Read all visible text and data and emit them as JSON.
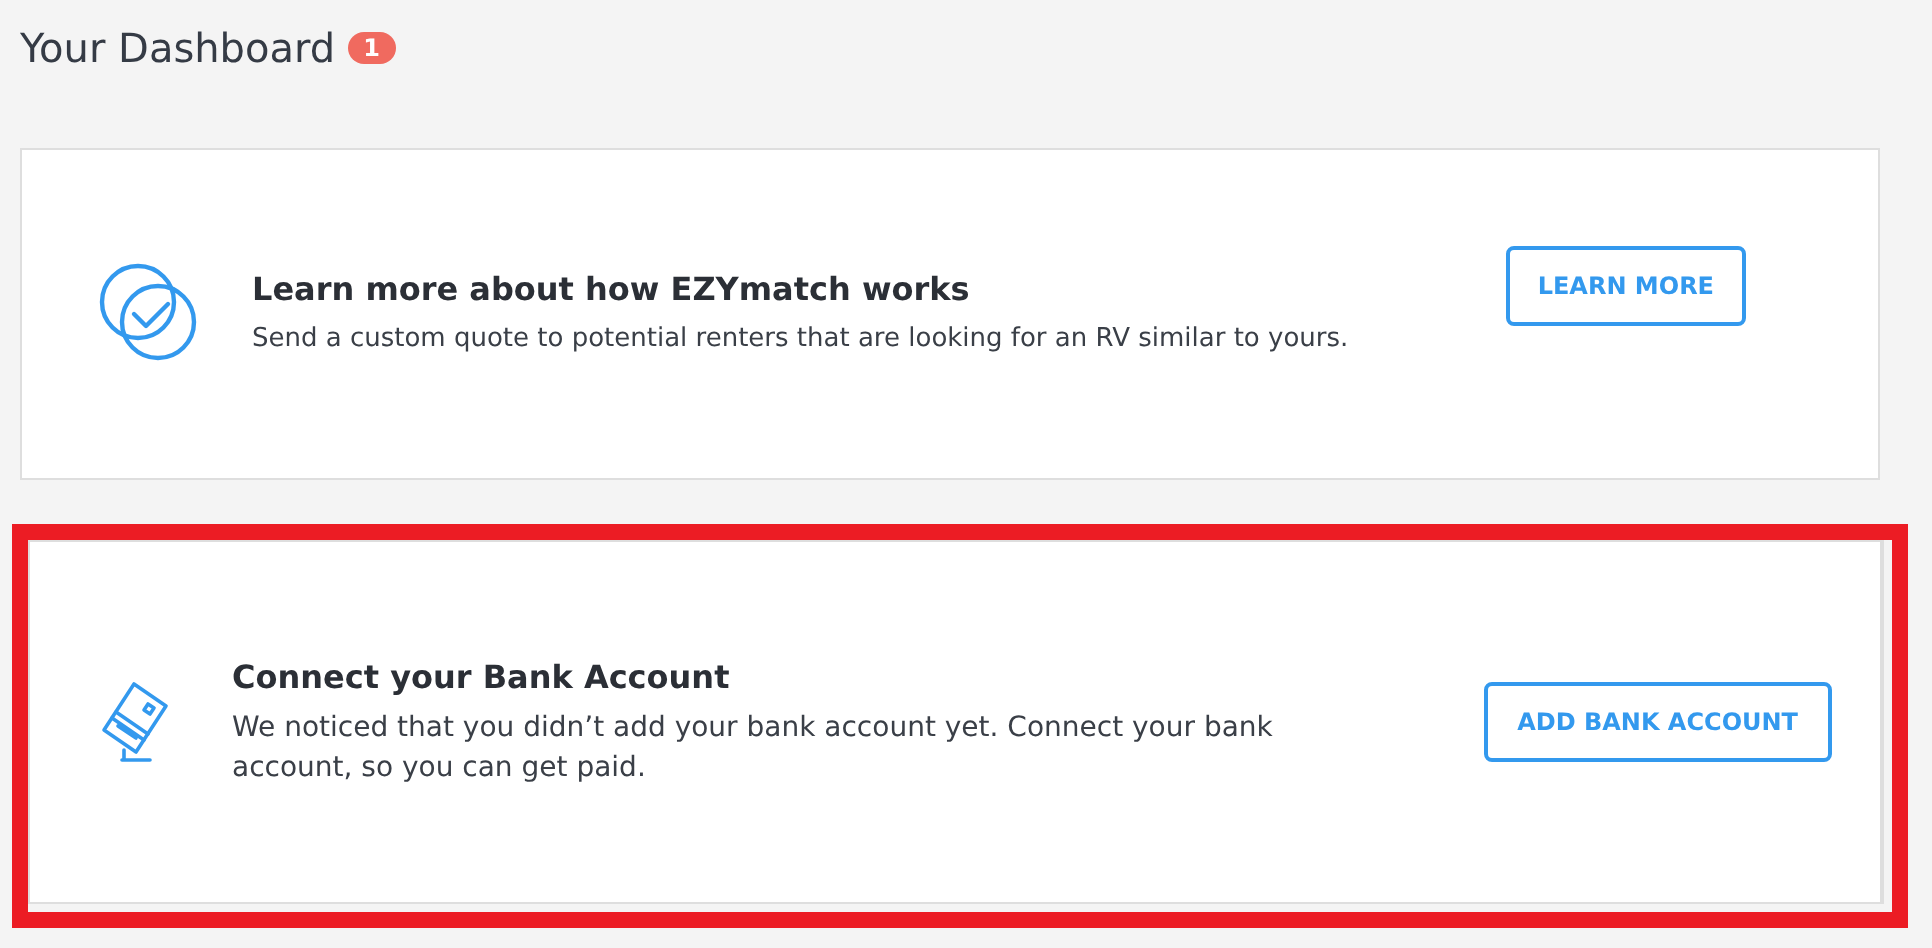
{
  "header": {
    "title": "Your Dashboard",
    "badge": "1"
  },
  "cards": [
    {
      "kind": "ezymatch",
      "title": "Learn more about how EZYmatch works",
      "description": "Send a custom quote to potential renters that are looking for an RV similar to yours.",
      "button": "LEARN MORE",
      "highlighted": false
    },
    {
      "kind": "bank",
      "title": "Connect your Bank Account",
      "description": "We noticed that you didn’t add your bank account yet. Connect your bank account, so you can get paid.",
      "button": "ADD BANK ACCOUNT",
      "highlighted": true
    }
  ]
}
